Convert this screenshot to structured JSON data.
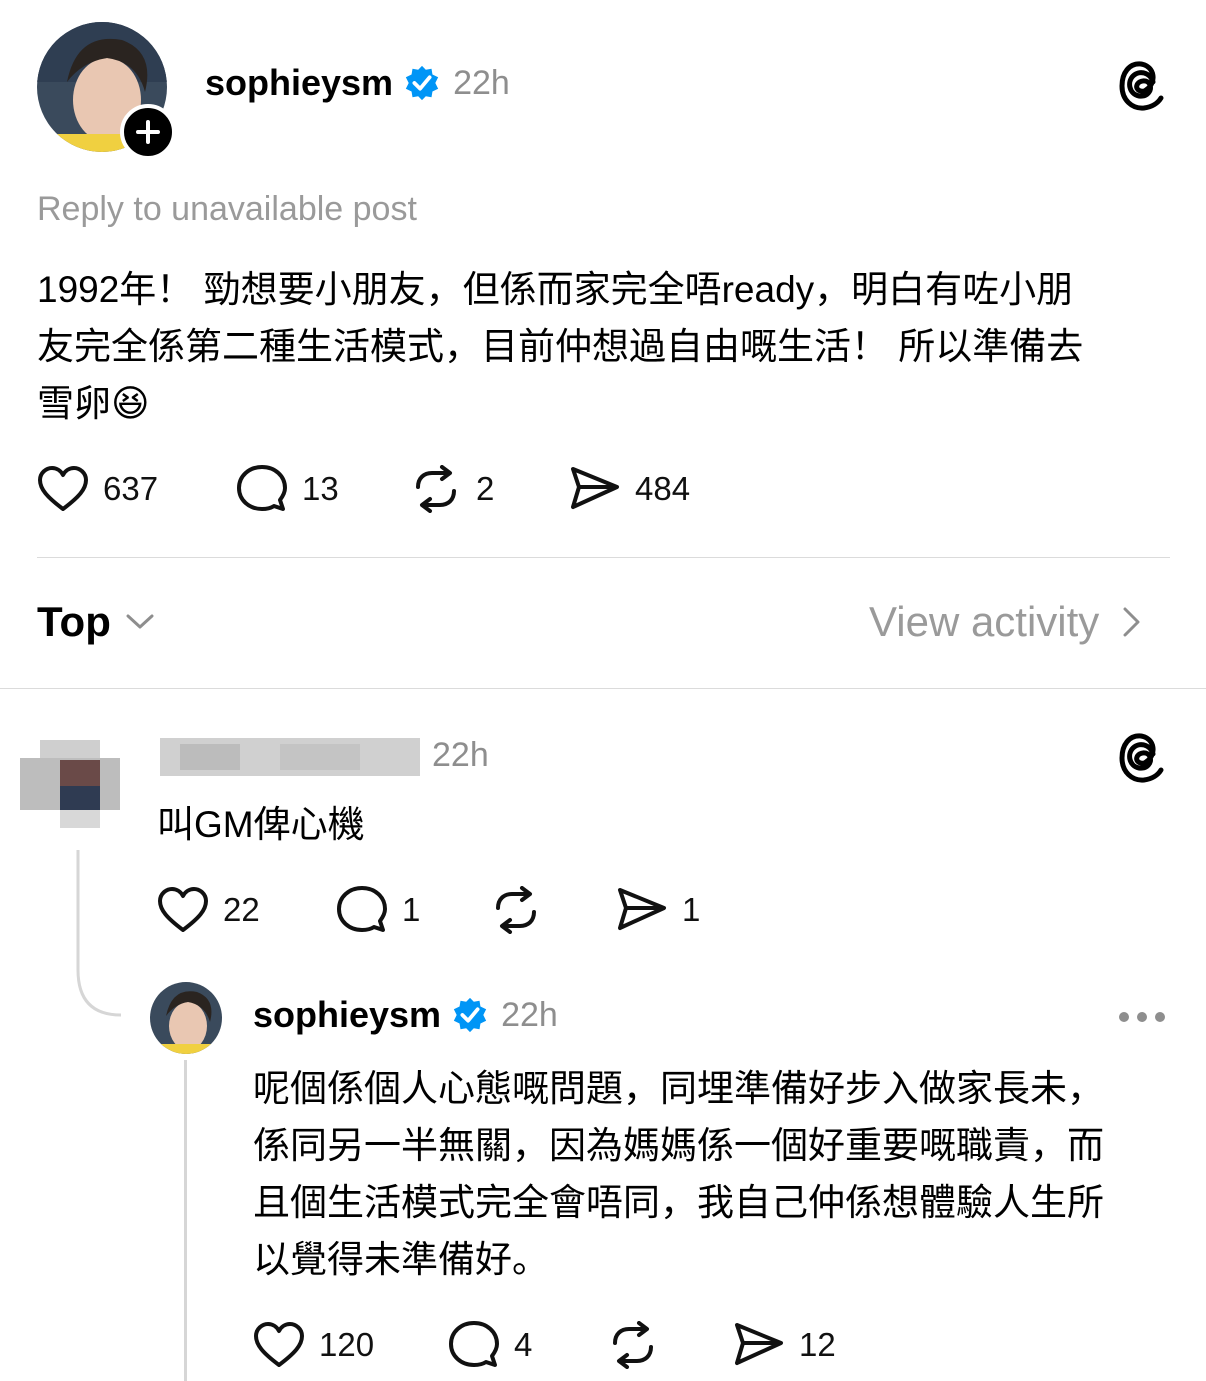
{
  "post": {
    "username": "sophieysm",
    "time": "22h",
    "reply_note": "Reply to unavailable post",
    "text_lines": [
      "1992年！ 勁想要小朋友，但係而家完全唔ready，明白有咗小朋",
      "友完全係第二種生活模式，目前仲想過自由嘅生活！ 所以準備去",
      "雪卵😆"
    ],
    "likes": "637",
    "comments": "13",
    "reposts": "2",
    "shares": "484"
  },
  "sort": {
    "label": "Top",
    "view_activity": "View activity"
  },
  "reply1": {
    "time": "22h",
    "text": "叫GM俾心機",
    "likes": "22",
    "comments": "1",
    "reposts": "",
    "shares": "1"
  },
  "reply2": {
    "username": "sophieysm",
    "time": "22h",
    "text_lines": [
      "呢個係個人心態嘅問題，同埋準備好步入做家長未，",
      "係同另一半無關，因為媽媽係一個好重要嘅職責，而",
      "且個生活模式完全會唔同，我自己仲係想體驗人生所",
      "以覺得未準備好。"
    ],
    "likes": "120",
    "comments": "4",
    "reposts": "",
    "shares": "12"
  },
  "colors": {
    "verified": "#0095f6",
    "muted": "#9a9a9a",
    "divider": "#dbdbdb"
  },
  "icons": [
    "threads-logo-icon",
    "verified-badge-icon",
    "plus-icon",
    "heart-icon",
    "comment-icon",
    "repost-icon",
    "share-icon",
    "chevron-down-icon",
    "chevron-right-icon",
    "more-icon"
  ]
}
